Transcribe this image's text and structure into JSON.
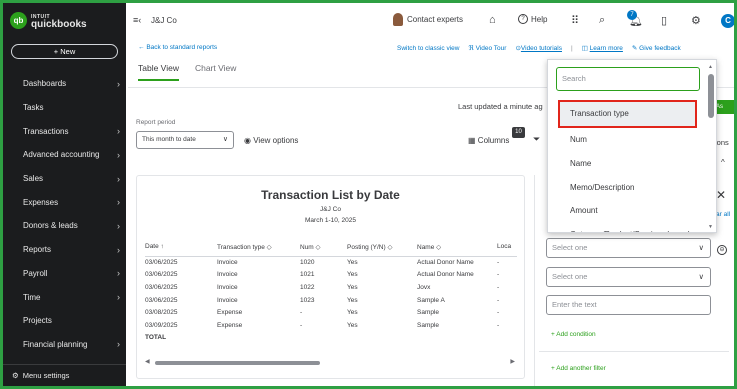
{
  "brand": {
    "small": "INTUIT",
    "big": "quickbooks",
    "mark": "qb"
  },
  "sidebar": {
    "new_label": "+ New",
    "items": [
      {
        "label": "Dashboards"
      },
      {
        "label": "Tasks"
      },
      {
        "label": "Transactions"
      },
      {
        "label": "Advanced accounting"
      },
      {
        "label": "Sales"
      },
      {
        "label": "Expenses"
      },
      {
        "label": "Donors & leads"
      },
      {
        "label": "Reports"
      },
      {
        "label": "Payroll"
      },
      {
        "label": "Time"
      },
      {
        "label": "Projects"
      },
      {
        "label": "Financial planning"
      }
    ],
    "menu_settings": "Menu settings"
  },
  "topbar": {
    "company": "J&J Co",
    "contact": "Contact experts",
    "help": "Help",
    "notif_count": "7",
    "user_initial": "C"
  },
  "subnav": {
    "back": "Back to standard reports",
    "switch": "Switch to classic view",
    "video_tour": "Video Tour",
    "video_tutorials": "Video tutorials",
    "learn_more": "Learn more",
    "feedback": "Give feedback"
  },
  "tabs": [
    {
      "label": "Table View"
    },
    {
      "label": "Chart View"
    }
  ],
  "controls": {
    "report_period_label": "Report period",
    "report_period_value": "This month to date",
    "view_options": "View options",
    "last_updated": "Last updated a minute ag",
    "columns": "Columns",
    "columns_count": "10",
    "partial_options": "ions",
    "green_btn": "As"
  },
  "report": {
    "title": "Transaction List by Date",
    "company": "J&J Co",
    "date_range": "March 1-10, 2025",
    "headers": [
      "Date ↑",
      "Transaction type ◇",
      "Num ◇",
      "Posting (Y/N) ◇",
      "Name ◇",
      "Loca"
    ],
    "rows": [
      [
        "03/06/2025",
        "Invoice",
        "1020",
        "Yes",
        "Actual Donor Name",
        "-"
      ],
      [
        "03/06/2025",
        "Invoice",
        "1021",
        "Yes",
        "Actual Donor Name",
        "-"
      ],
      [
        "03/06/2025",
        "Invoice",
        "1022",
        "Yes",
        "Jovx",
        "-"
      ],
      [
        "03/06/2025",
        "Invoice",
        "1023",
        "Yes",
        "Sample A",
        "-"
      ],
      [
        "03/08/2025",
        "Expense",
        "-",
        "Yes",
        "Sample",
        "-"
      ],
      [
        "03/09/2025",
        "Expense",
        "-",
        "Yes",
        "Sample",
        "-"
      ]
    ],
    "total_label": "TOTAL"
  },
  "filter_panel": {
    "clear_all": "ar all",
    "select_one_1": "Select one",
    "select_one_2": "Select one",
    "enter_text": "Enter the text",
    "add_condition": "+ Add condition",
    "add_filter": "+ Add another filter"
  },
  "dropdown": {
    "search_placeholder": "Search",
    "items": [
      {
        "label": "Transaction type"
      },
      {
        "label": "Num"
      },
      {
        "label": "Name"
      },
      {
        "label": "Memo/Description"
      },
      {
        "label": "Amount"
      },
      {
        "label": "Category/Product/Service cleared"
      }
    ]
  },
  "colors": {
    "accent": "#2ca01c",
    "link": "#0077c5",
    "highlight_border": "#e1251b",
    "frame": "#2ea043"
  }
}
